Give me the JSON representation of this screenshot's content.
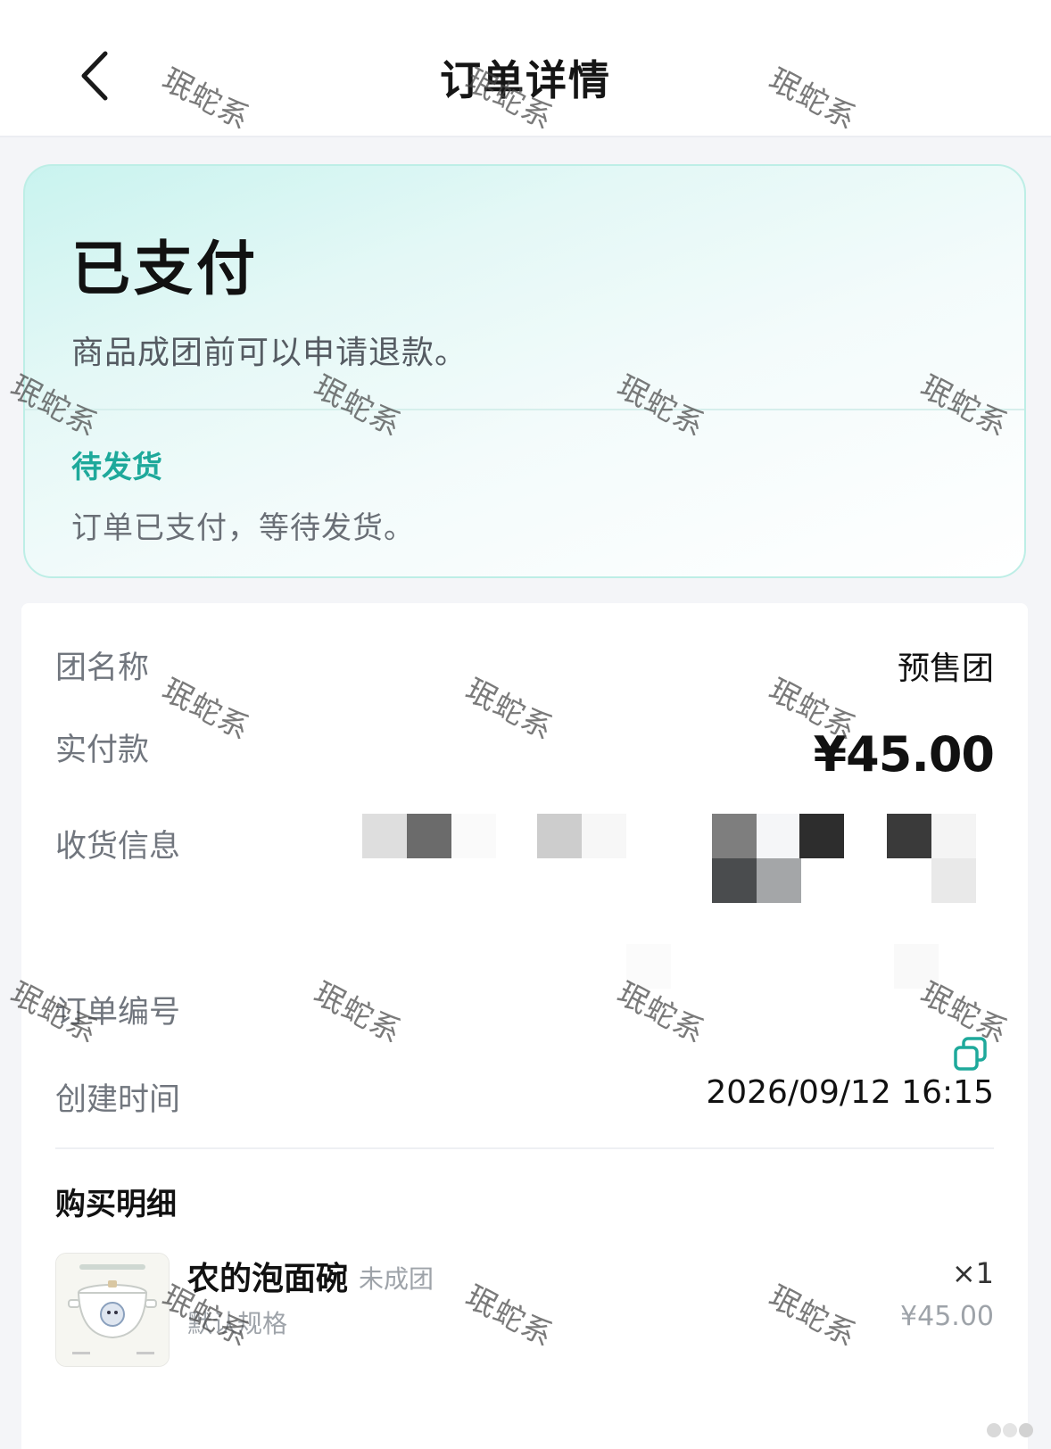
{
  "header": {
    "title": "订单详情",
    "back_icon": "chevron-left-icon"
  },
  "status": {
    "title": "已支付",
    "description": "商品成团前可以申请退款。",
    "shipping_status": "待发货",
    "shipping_description": "订单已支付，等待发货。",
    "accent_color": "#1ea99b"
  },
  "order_info": {
    "group_name_label": "团名称",
    "group_name_value": "预售团",
    "paid_label": "实付款",
    "paid_value": "¥45.00",
    "shipping_info_label": "收货信息",
    "order_number_label": "订单编号",
    "copy_icon": "copy-icon",
    "created_label": "创建时间",
    "created_value": "2026/09/12 16:15"
  },
  "purchase": {
    "title": "购买明细",
    "items": [
      {
        "name": "农的泡面碗",
        "badge": "未成团",
        "spec": "默认规格",
        "qty": "×1",
        "price": "¥45.00"
      }
    ]
  },
  "watermark": {
    "text": "珉蛇系"
  }
}
